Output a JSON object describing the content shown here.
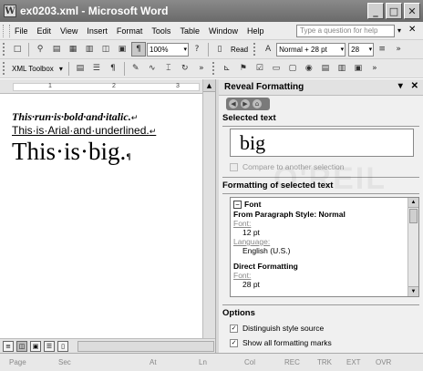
{
  "window": {
    "title": "ex0203.xml - Microsoft Word",
    "app_icon": "W"
  },
  "menu": {
    "items": [
      "File",
      "Edit",
      "View",
      "Insert",
      "Format",
      "Tools",
      "Table",
      "Window",
      "Help"
    ],
    "help_placeholder": "Type a question for help"
  },
  "toolbar1": {
    "zoom": "100%",
    "read_label": "Read",
    "style": "Normal + 28 pt",
    "font_size": "28"
  },
  "toolbar2": {
    "xml_toolbox": "XML Toolbox"
  },
  "document": {
    "line1": "This·run·is·bold·and·italic.",
    "line2": "This·is·Arial·and·underlined.",
    "line3": "This·is·big.",
    "line_break_mark": "↵",
    "para_mark": "¶",
    "ruler_marks": [
      "1",
      "2",
      "3"
    ]
  },
  "pane": {
    "title": "Reveal Formatting",
    "selected_text_header": "Selected text",
    "sample_text": "big",
    "compare_label": "Compare to another selection",
    "formatting_header": "Formatting of selected text",
    "font_group": "Font",
    "from_style_header": "From Paragraph Style: Normal",
    "font_link": "Font:",
    "font_value_1": "12 pt",
    "language_link": "Language:",
    "language_value": "English (U.S.)",
    "direct_header": "Direct Formatting",
    "font_value_2": "28 pt",
    "options_header": "Options",
    "opt1_label": "Distinguish style source",
    "opt2_label": "Show all formatting marks"
  },
  "watermark": "O'REIL",
  "status": [
    "Page",
    "Sec",
    "At",
    "Ln",
    "Col",
    "REC",
    "TRK",
    "EXT",
    "OVR"
  ]
}
